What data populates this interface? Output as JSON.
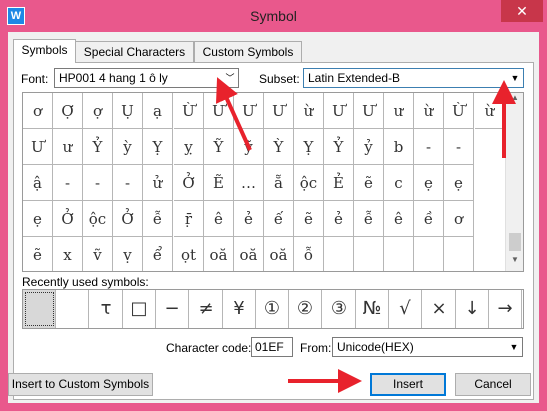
{
  "window": {
    "title": "Symbol",
    "icon": "wps-writer-icon",
    "close_glyph": "✕"
  },
  "tabs": [
    {
      "label": "Symbols",
      "active": true
    },
    {
      "label": "Special Characters",
      "active": false
    },
    {
      "label": "Custom Symbols",
      "active": false
    }
  ],
  "font": {
    "label": "Font:",
    "value": "HP001 4 hang 1 ô ly"
  },
  "subset": {
    "label": "Subset:",
    "value": "Latin Extended-B"
  },
  "symbol_grid": [
    [
      "ơ",
      "Ợ",
      "ợ",
      "Ụ",
      "ạ",
      "Ừ",
      "Ư",
      "Ư",
      "Ư",
      "ừ",
      "Ư",
      "Ư",
      "ư",
      "ừ",
      "Ừ",
      "ừ"
    ],
    [
      "Ư",
      "ư",
      "Ỷ",
      "ỳ",
      "Ỵ",
      "ỵ",
      "Ỹ",
      "ỹ",
      "Ỳ",
      "Ỵ",
      "Ỷ",
      "ỷ",
      "b",
      "-",
      "-"
    ],
    [
      "ậ",
      "-",
      "-",
      "-",
      "ử",
      "Ở",
      "Ẽ",
      "…",
      "ẵ",
      "ộc",
      "Ẻ",
      "ẽ",
      "c",
      "ẹ",
      "ẹ"
    ],
    [
      "ẹ",
      "Ở",
      "ộc",
      "Ở",
      "ễ",
      "ṝ",
      "ê",
      "ẻ",
      "ế",
      "ẽ",
      "ẻ",
      "ễ",
      "ê",
      "ề",
      "ơ"
    ],
    [
      "ẽ",
      "x",
      "ṽ",
      "ṿ",
      "ể",
      "ọt",
      "oă",
      "oă",
      "oă",
      "ỗ",
      "",
      "",
      "",
      "",
      ""
    ]
  ],
  "scrollbar": {
    "up_glyph": "▲",
    "down_glyph": "▼"
  },
  "recent": {
    "label": "Recently used symbols:",
    "items": [
      "",
      "",
      "τ",
      "□",
      "−",
      "≠",
      "¥",
      "①",
      "②",
      "③",
      "№",
      "√",
      "×",
      "↓",
      "→"
    ]
  },
  "character_code": {
    "label": "Character code:",
    "value": "01EF"
  },
  "from": {
    "label": "From:",
    "value": "Unicode(HEX)"
  },
  "buttons": {
    "insert_custom": "Insert to Custom Symbols",
    "insert": "Insert",
    "cancel": "Cancel"
  },
  "colors": {
    "annotation_arrow": "#e8222c",
    "window_frame": "#e9588c"
  }
}
